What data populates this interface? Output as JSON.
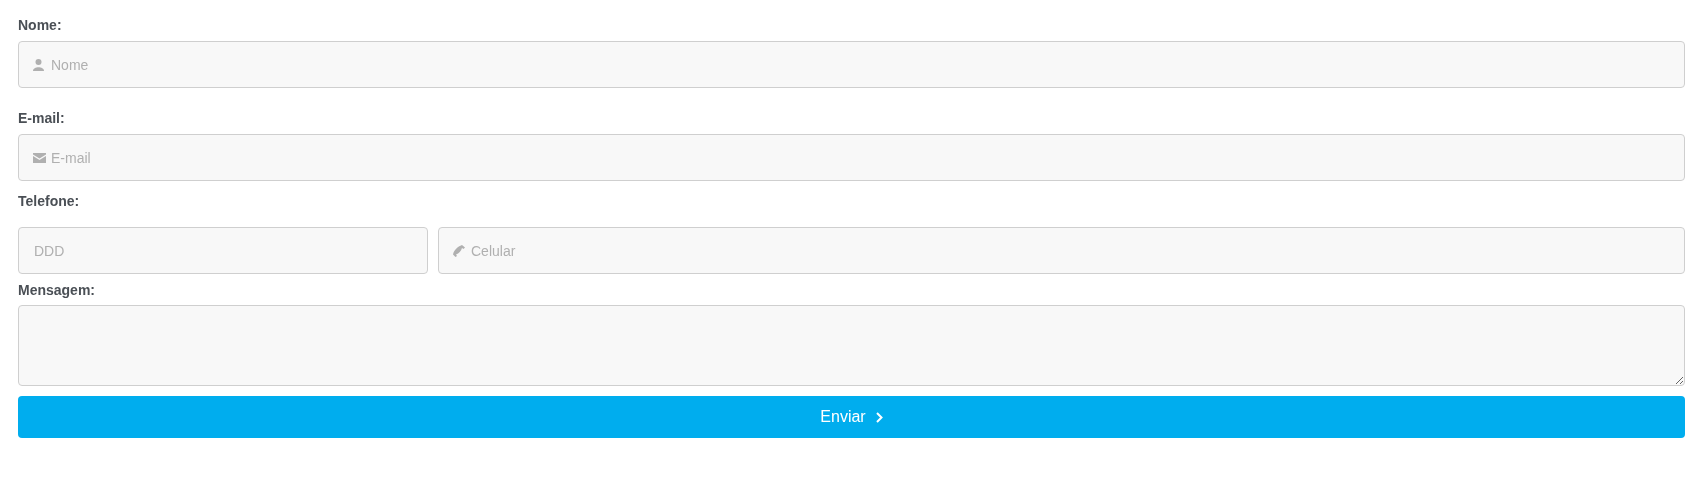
{
  "fields": [
    {
      "label": "Nome:",
      "inputs": [
        {
          "kind": "person",
          "placeholder": "Nome"
        }
      ]
    },
    {
      "label": "E-mail:",
      "inputs": [
        {
          "kind": "envelope",
          "placeholder": "E-mail"
        }
      ]
    },
    {
      "label": "Telefone:",
      "inputs": [
        {
          "kind": "plain",
          "placeholder": "DDD"
        },
        {
          "kind": "phone",
          "placeholder": "Celular"
        }
      ]
    },
    {
      "label": "Mensagem:",
      "inputs": [
        {
          "kind": "textarea"
        }
      ]
    }
  ],
  "submit": {
    "label": "Enviar"
  }
}
